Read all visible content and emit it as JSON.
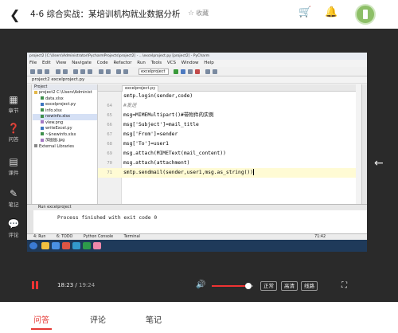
{
  "header": {
    "title": "4-6 综合实战：某培训机构就业数据分析",
    "favorite_label": "收藏"
  },
  "sidenav": [
    {
      "icon": "book-icon",
      "label": "章节"
    },
    {
      "icon": "question-icon",
      "label": "问答"
    },
    {
      "icon": "courseware-icon",
      "label": "课件"
    },
    {
      "icon": "note-icon",
      "label": "笔记"
    },
    {
      "icon": "comment-icon",
      "label": "评论"
    }
  ],
  "ide": {
    "title": "project2 [C:\\Users\\Administrator\\PycharmProjects\\project2] - ...\\excelproject.py [project2] - PyCharm",
    "menu": [
      "File",
      "Edit",
      "View",
      "Navigate",
      "Code",
      "Refactor",
      "Run",
      "Tools",
      "VCS",
      "Window",
      "Help"
    ],
    "run_config": "excelproject",
    "breadcrumb": "project2  excelproject.py",
    "project_header": "Project",
    "tree": [
      "project2  C:\\Users\\Administ",
      "data.xlsx",
      "excelproject.py",
      "info.xlsx",
      "newinfo.xlsx",
      "view.png",
      "writeExcel.py",
      "~$newinfo.xlsx",
      "加图图.jpg",
      "External Libraries"
    ],
    "editor_tab": "excelproject.py",
    "code": [
      {
        "line": "",
        "text": "smtp.login(sender,code)"
      },
      {
        "line": "64",
        "text": "#发送"
      },
      {
        "line": "65",
        "text": "msg=MIMEMultipart()#带附件的实例"
      },
      {
        "line": "66",
        "text": "msg['Subject']=mail_title"
      },
      {
        "line": "67",
        "text": "msg['From']=sender"
      },
      {
        "line": "68",
        "text": "msg['To']=user1"
      },
      {
        "line": "69",
        "text": "msg.attach(MIMEText(mail_content))"
      },
      {
        "line": "70",
        "text": "msg.attach(attachment)"
      },
      {
        "line": "71",
        "text": "smtp.sendmail(sender,user1,msg.as_string())"
      }
    ],
    "run_header": "Run  excelproject",
    "run_output": "Process finished with exit code 0",
    "tool_tabs": [
      "4: Run",
      "6: TODO",
      "Python Console",
      "Terminal"
    ],
    "clock": "71:42"
  },
  "player": {
    "current_time": "18:23",
    "duration": "19:24",
    "volume_level": 0.88,
    "quality_buttons": [
      "正常",
      "高清",
      "线路"
    ]
  },
  "tabs": [
    {
      "label": "问答",
      "active": true
    },
    {
      "label": "评论",
      "active": false
    },
    {
      "label": "笔记",
      "active": false
    }
  ],
  "colors": {
    "accent": "#e53935",
    "dark_bg": "#2a2a2a"
  }
}
